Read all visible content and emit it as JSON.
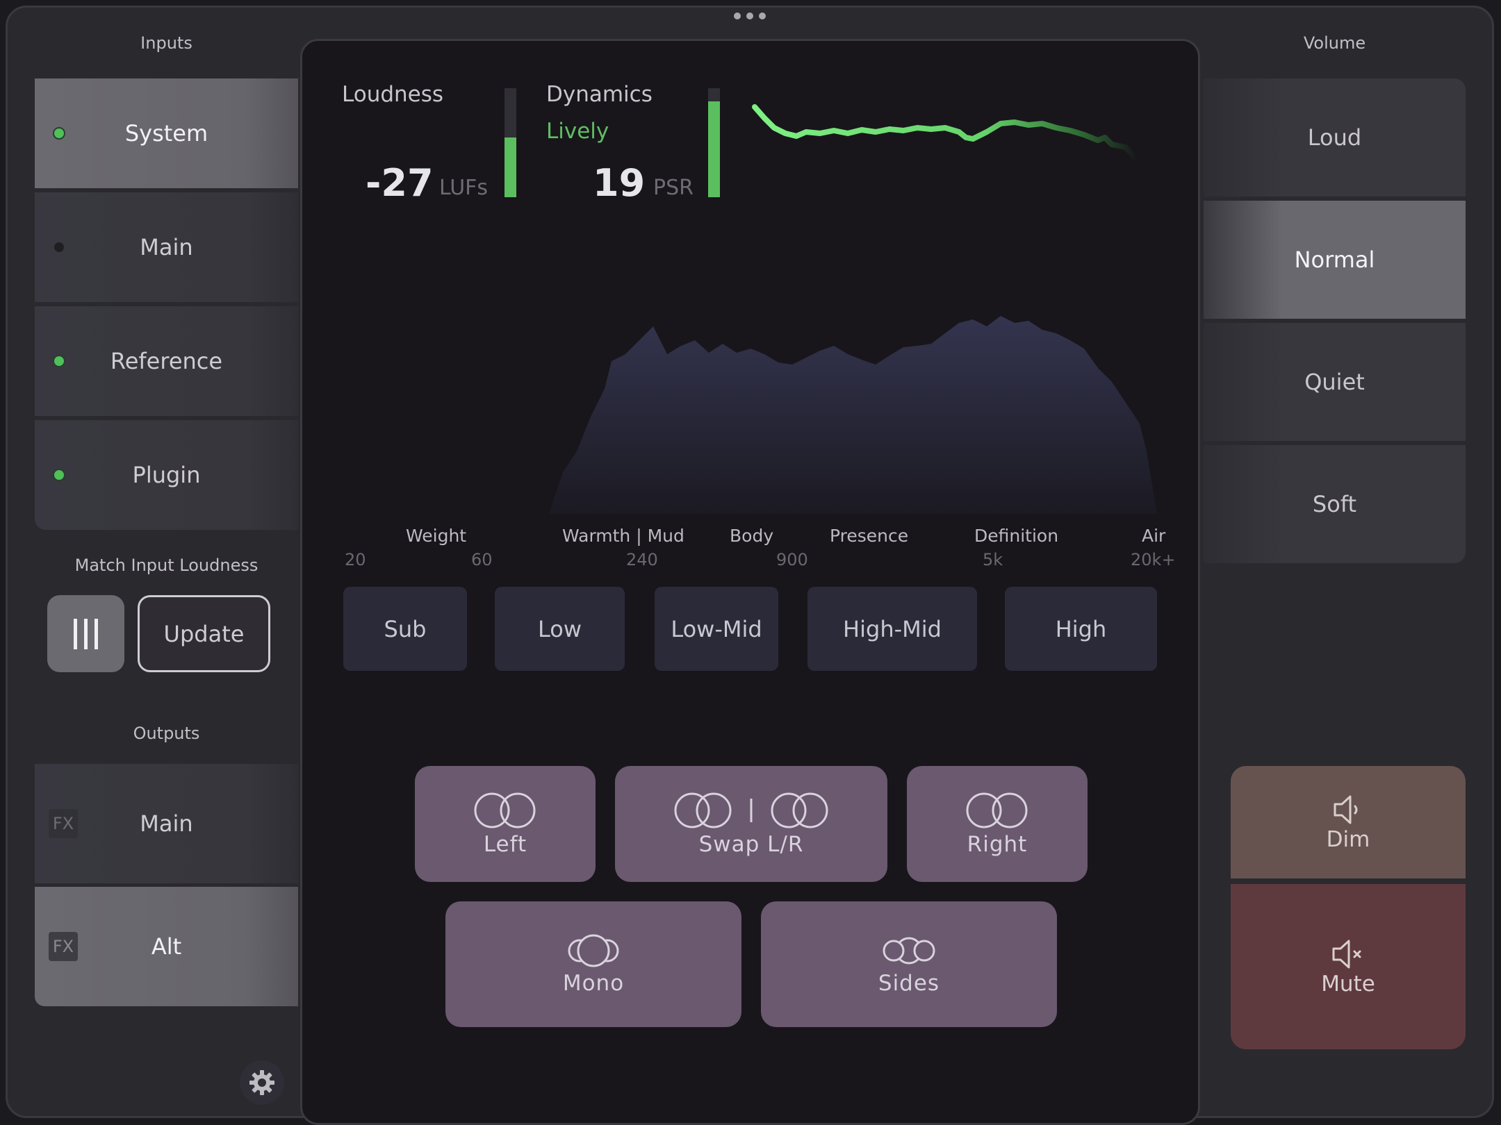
{
  "left": {
    "inputs_title": "Inputs",
    "inputs": [
      {
        "label": "System",
        "active": true,
        "indicator": "on"
      },
      {
        "label": "Main",
        "active": false,
        "indicator": "off"
      },
      {
        "label": "Reference",
        "active": false,
        "indicator": "on"
      },
      {
        "label": "Plugin",
        "active": false,
        "indicator": "on"
      }
    ],
    "match_title": "Match Input Loudness",
    "update_label": "Update",
    "outputs_title": "Outputs",
    "outputs": [
      {
        "label": "Main",
        "badge": "FX",
        "active": false
      },
      {
        "label": "Alt",
        "badge": "FX",
        "active": true
      }
    ]
  },
  "meters": {
    "loudness_label": "Loudness",
    "loudness_value": "-27",
    "loudness_unit": "LUFs",
    "loudness_level": 0.55,
    "dynamics_label": "Dynamics",
    "dynamics_state": "Lively",
    "dynamics_value": "19",
    "dynamics_unit": "PSR",
    "dynamics_level": 0.88
  },
  "spectrum": {
    "band_names": [
      "Weight",
      "Warmth | Mud",
      "Body",
      "Presence",
      "Definition",
      "Air"
    ],
    "freqs": [
      "20",
      "60",
      "240",
      "900",
      "5k",
      "20k+"
    ]
  },
  "bands": [
    "Sub",
    "Low",
    "Low-Mid",
    "High-Mid",
    "High"
  ],
  "stereo": {
    "left": "Left",
    "swap": "Swap L/R",
    "right": "Right",
    "mono": "Mono",
    "sides": "Sides"
  },
  "right": {
    "volume_title": "Volume",
    "volumes": [
      {
        "label": "Loud",
        "active": false
      },
      {
        "label": "Normal",
        "active": true
      },
      {
        "label": "Quiet",
        "active": false
      },
      {
        "label": "Soft",
        "active": false
      }
    ],
    "dim_label": "Dim",
    "mute_label": "Mute"
  },
  "colors": {
    "accent_green": "#5bbf5f",
    "dynamics_text": "#5fbf63",
    "stereo_button": "#6a596f",
    "dim_button": "#665350",
    "mute_button": "#5e3a3e"
  }
}
